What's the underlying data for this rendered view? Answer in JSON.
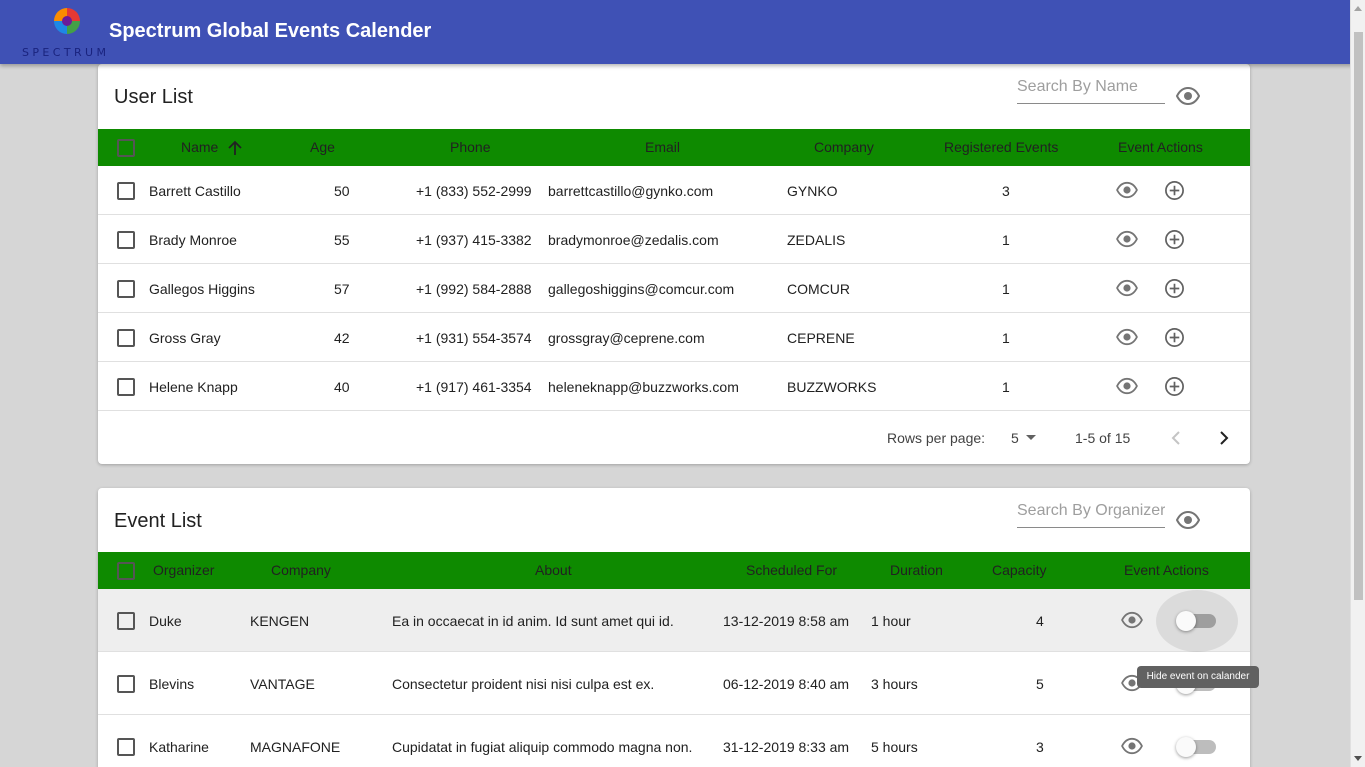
{
  "app": {
    "title": "Spectrum Global Events Calender",
    "logo_text": "SPECTRUM"
  },
  "user_list": {
    "title": "User List",
    "search_placeholder": "Search By Name",
    "columns": [
      "Name",
      "Age",
      "Phone",
      "Email",
      "Company",
      "Registered Events",
      "Event Actions"
    ],
    "rows": [
      {
        "name": "Barrett Castillo",
        "age": "50",
        "phone": "+1 (833) 552-2999",
        "email": "barrettcastillo@gynko.com",
        "company": "GYNKO",
        "registered": "3"
      },
      {
        "name": "Brady Monroe",
        "age": "55",
        "phone": "+1 (937) 415-3382",
        "email": "bradymonroe@zedalis.com",
        "company": "ZEDALIS",
        "registered": "1"
      },
      {
        "name": "Gallegos Higgins",
        "age": "57",
        "phone": "+1 (992) 584-2888",
        "email": "gallegoshiggins@comcur.com",
        "company": "COMCUR",
        "registered": "1"
      },
      {
        "name": "Gross Gray",
        "age": "42",
        "phone": "+1 (931) 554-3574",
        "email": "grossgray@ceprene.com",
        "company": "CEPRENE",
        "registered": "1"
      },
      {
        "name": "Helene Knapp",
        "age": "40",
        "phone": "+1 (917) 461-3354",
        "email": "heleneknapp@buzzworks.com",
        "company": "BUZZWORKS",
        "registered": "1"
      }
    ],
    "pagination": {
      "rows_per_page_label": "Rows per page:",
      "rows_per_page": "5",
      "range": "1-5 of 15"
    }
  },
  "event_list": {
    "title": "Event List",
    "search_placeholder": "Search By Organizer",
    "columns": [
      "Organizer",
      "Company",
      "About",
      "Scheduled For",
      "Duration",
      "Capacity",
      "Event Actions"
    ],
    "rows": [
      {
        "organizer": "Duke",
        "company": "KENGEN",
        "about": "Ea in occaecat in id anim. Id sunt amet qui id.",
        "scheduled": "13-12-2019 8:58 am",
        "duration": "1 hour",
        "capacity": "4"
      },
      {
        "organizer": "Blevins",
        "company": "VANTAGE",
        "about": "Consectetur proident nisi nisi culpa est ex.",
        "scheduled": "06-12-2019 8:40 am",
        "duration": "3 hours",
        "capacity": "5"
      },
      {
        "organizer": "Katharine",
        "company": "MAGNAFONE",
        "about": "Cupidatat in fugiat aliquip commodo magna non.",
        "scheduled": "31-12-2019 8:33 am",
        "duration": "5 hours",
        "capacity": "3"
      }
    ],
    "tooltip": "Hide event on calander"
  },
  "icons": {
    "view": "eye-icon",
    "add": "add-circle-icon",
    "sort": "arrow-up-icon",
    "prev": "chevron-left-icon",
    "next": "chevron-right-icon",
    "dropdown": "caret-down-icon"
  },
  "colors": {
    "appbar": "#3f51b5",
    "table_header": "#0e8a00",
    "background": "#d6d6d6"
  }
}
